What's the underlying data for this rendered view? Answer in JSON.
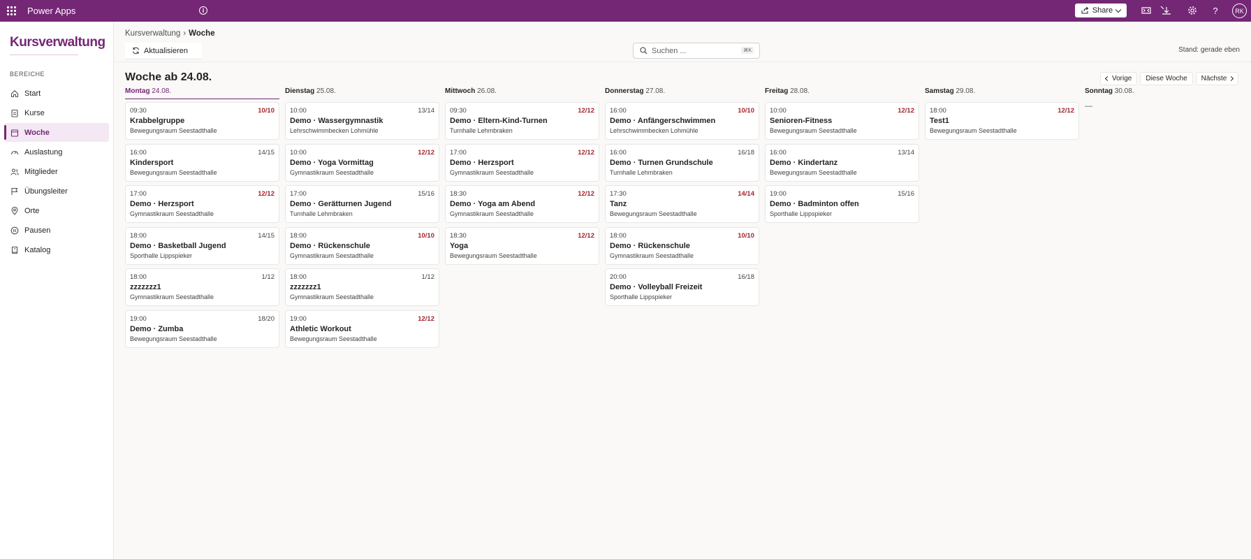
{
  "app": {
    "name": "Power Apps",
    "share_label": "Share",
    "user_initials": "RK"
  },
  "sidebar": {
    "brand": "Kursverwaltung",
    "section_label": "BEREICHE",
    "items": [
      {
        "label": "Start",
        "icon": "home-icon"
      },
      {
        "label": "Kurse",
        "icon": "clipboard-icon"
      },
      {
        "label": "Woche",
        "icon": "calendar-icon",
        "active": true
      },
      {
        "label": "Auslastung",
        "icon": "gauge-icon"
      },
      {
        "label": "Mitglieder",
        "icon": "people-icon"
      },
      {
        "label": "Übungsleiter",
        "icon": "flag-icon"
      },
      {
        "label": "Orte",
        "icon": "location-icon"
      },
      {
        "label": "Pausen",
        "icon": "pause-icon"
      },
      {
        "label": "Katalog",
        "icon": "book-icon"
      }
    ]
  },
  "breadcrumb": {
    "parent": "Kursverwaltung",
    "separator": "›",
    "current": "Woche"
  },
  "toolbar": {
    "refresh_label": "Aktualisieren",
    "search_placeholder": "Suchen ...",
    "search_shortcut": "⌘K",
    "status": "Stand: gerade eben"
  },
  "week": {
    "title": "Woche ab 24.08.",
    "nav": {
      "prev": "Vorige",
      "current": "Diese Woche",
      "next": "Nächste"
    },
    "empty_marker": "—",
    "days": [
      {
        "name": "Montag",
        "date": "24.08.",
        "courses": [
          {
            "time": "09:30",
            "occupancy": "10/10",
            "full": true,
            "title": "Krabbelgruppe",
            "room": "Bewegungsraum Seestadthalle"
          },
          {
            "time": "16:00",
            "occupancy": "14/15",
            "full": false,
            "title": "Kindersport",
            "room": "Bewegungsraum Seestadthalle"
          },
          {
            "time": "17:00",
            "occupancy": "12/12",
            "full": true,
            "title": "Demo · Herzsport",
            "room": "Gymnastikraum Seestadthalle"
          },
          {
            "time": "18:00",
            "occupancy": "14/15",
            "full": false,
            "title": "Demo · Basketball Jugend",
            "room": "Sporthalle Lippspieker"
          },
          {
            "time": "18:00",
            "occupancy": "1/12",
            "full": false,
            "title": "zzzzzzz1",
            "room": "Gymnastikraum Seestadthalle"
          },
          {
            "time": "19:00",
            "occupancy": "18/20",
            "full": false,
            "title": "Demo · Zumba",
            "room": "Bewegungsraum Seestadthalle"
          }
        ]
      },
      {
        "name": "Dienstag",
        "date": "25.08.",
        "courses": [
          {
            "time": "10:00",
            "occupancy": "13/14",
            "full": false,
            "title": "Demo · Wassergymnastik",
            "room": "Lehrschwimmbecken Lohmühle"
          },
          {
            "time": "10:00",
            "occupancy": "12/12",
            "full": true,
            "title": "Demo · Yoga Vormittag",
            "room": "Gymnastikraum Seestadthalle"
          },
          {
            "time": "17:00",
            "occupancy": "15/16",
            "full": false,
            "title": "Demo · Gerätturnen Jugend",
            "room": "Turnhalle Lehmbraken"
          },
          {
            "time": "18:00",
            "occupancy": "10/10",
            "full": true,
            "title": "Demo · Rückenschule",
            "room": "Gymnastikraum Seestadthalle"
          },
          {
            "time": "18:00",
            "occupancy": "1/12",
            "full": false,
            "title": "zzzzzzz1",
            "room": "Gymnastikraum Seestadthalle"
          },
          {
            "time": "19:00",
            "occupancy": "12/12",
            "full": true,
            "title": "Athletic Workout",
            "room": "Bewegungsraum Seestadthalle"
          }
        ]
      },
      {
        "name": "Mittwoch",
        "date": "26.08.",
        "courses": [
          {
            "time": "09:30",
            "occupancy": "12/12",
            "full": true,
            "title": "Demo · Eltern-Kind-Turnen",
            "room": "Turnhalle Lehmbraken"
          },
          {
            "time": "17:00",
            "occupancy": "12/12",
            "full": true,
            "title": "Demo · Herzsport",
            "room": "Gymnastikraum Seestadthalle"
          },
          {
            "time": "18:30",
            "occupancy": "12/12",
            "full": true,
            "title": "Demo · Yoga am Abend",
            "room": "Gymnastikraum Seestadthalle"
          },
          {
            "time": "18:30",
            "occupancy": "12/12",
            "full": true,
            "title": "Yoga",
            "room": "Bewegungsraum Seestadthalle"
          }
        ]
      },
      {
        "name": "Donnerstag",
        "date": "27.08.",
        "courses": [
          {
            "time": "16:00",
            "occupancy": "10/10",
            "full": true,
            "title": "Demo · Anfängerschwimmen",
            "room": "Lehrschwimmbecken Lohmühle"
          },
          {
            "time": "16:00",
            "occupancy": "16/18",
            "full": false,
            "title": "Demo · Turnen Grundschule",
            "room": "Turnhalle Lehmbraken"
          },
          {
            "time": "17:30",
            "occupancy": "14/14",
            "full": true,
            "title": "Tanz",
            "room": "Bewegungsraum Seestadthalle"
          },
          {
            "time": "18:00",
            "occupancy": "10/10",
            "full": true,
            "title": "Demo · Rückenschule",
            "room": "Gymnastikraum Seestadthalle"
          },
          {
            "time": "20:00",
            "occupancy": "16/18",
            "full": false,
            "title": "Demo · Volleyball Freizeit",
            "room": "Sporthalle Lippspieker"
          }
        ]
      },
      {
        "name": "Freitag",
        "date": "28.08.",
        "courses": [
          {
            "time": "10:00",
            "occupancy": "12/12",
            "full": true,
            "title": "Senioren-Fitness",
            "room": "Bewegungsraum Seestadthalle"
          },
          {
            "time": "16:00",
            "occupancy": "13/14",
            "full": false,
            "title": "Demo · Kindertanz",
            "room": "Bewegungsraum Seestadthalle"
          },
          {
            "time": "19:00",
            "occupancy": "15/16",
            "full": false,
            "title": "Demo · Badminton offen",
            "room": "Sporthalle Lippspieker"
          }
        ]
      },
      {
        "name": "Samstag",
        "date": "29.08.",
        "courses": [
          {
            "time": "18:00",
            "occupancy": "12/12",
            "full": true,
            "title": "Test1",
            "room": "Bewegungsraum Seestadthalle"
          }
        ]
      },
      {
        "name": "Sonntag",
        "date": "30.08.",
        "courses": []
      }
    ]
  }
}
